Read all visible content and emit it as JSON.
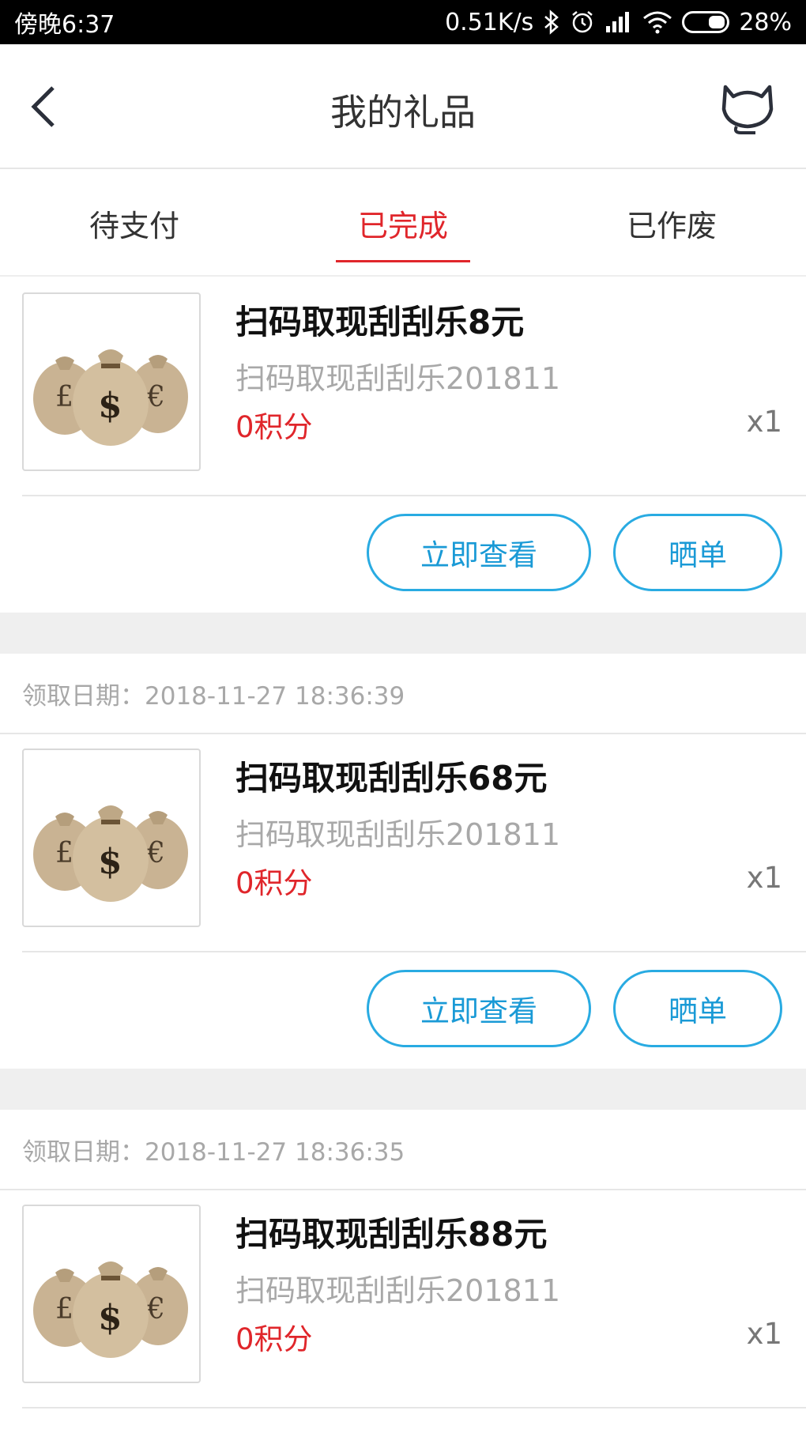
{
  "status_bar": {
    "time": "傍晚6:37",
    "net_speed": "0.51K/s",
    "battery": "28%"
  },
  "header": {
    "title": "我的礼品"
  },
  "tabs": [
    {
      "label": "待支付",
      "active": false
    },
    {
      "label": "已完成",
      "active": true
    },
    {
      "label": "已作废",
      "active": false
    }
  ],
  "orders": [
    {
      "date": "",
      "title": "扫码取现刮刮乐8元",
      "subtitle": "扫码取现刮刮乐201811",
      "points": "0积分",
      "qty": "x1",
      "view_label": "立即查看",
      "share_label": "晒单"
    },
    {
      "date": "领取日期：2018-11-27 18:36:39",
      "title": "扫码取现刮刮乐68元",
      "subtitle": "扫码取现刮刮乐201811",
      "points": "0积分",
      "qty": "x1",
      "view_label": "立即查看",
      "share_label": "晒单"
    },
    {
      "date": "领取日期：2018-11-27 18:36:35",
      "title": "扫码取现刮刮乐88元",
      "subtitle": "扫码取现刮刮乐201811",
      "points": "0积分",
      "qty": "x1"
    }
  ],
  "colors": {
    "accent_red": "#e0262b",
    "button_blue": "#29abe2",
    "divider_gray": "#efefef"
  }
}
